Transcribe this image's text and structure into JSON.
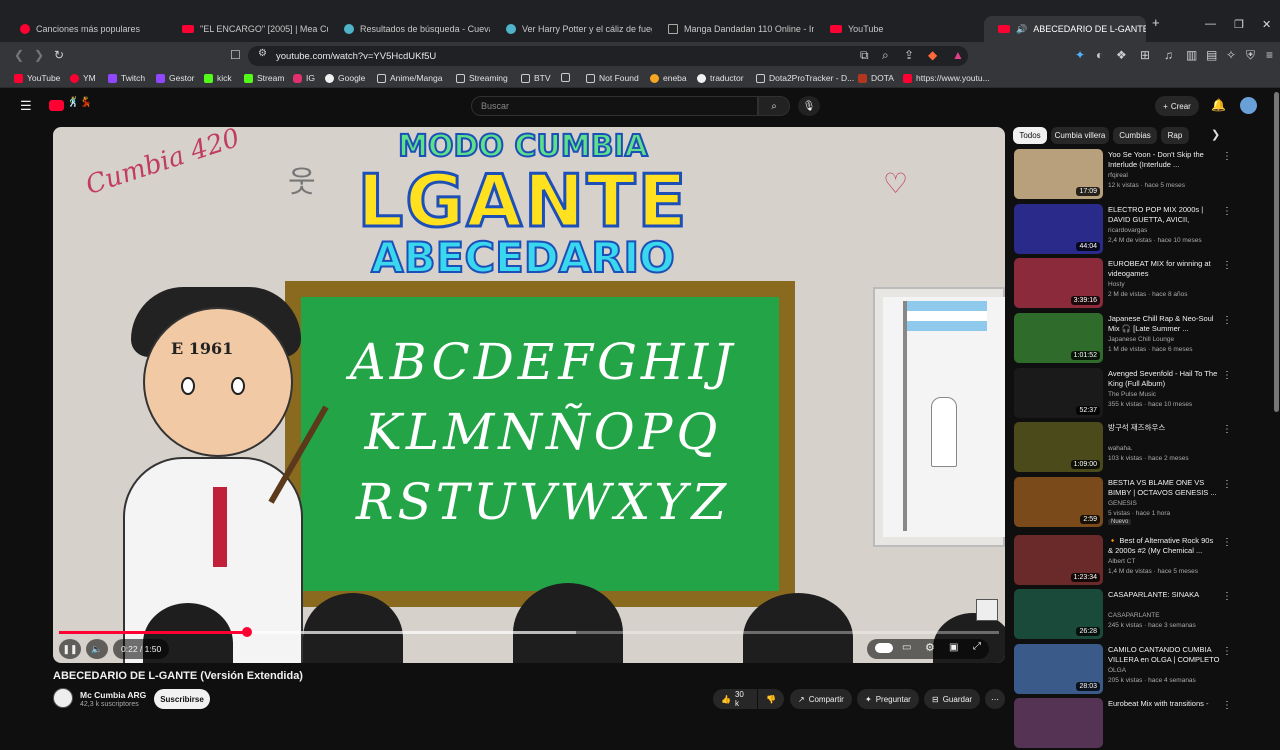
{
  "browser": {
    "tabs": [
      {
        "label": "Canciones más populares",
        "active": false
      },
      {
        "label": "\"EL ENCARGO\" [2005] | Mea Culpa. A...",
        "active": false
      },
      {
        "label": "Resultados de búsqueda - Cueva...",
        "active": false
      },
      {
        "label": "Ver Harry Potter y el cáliz de fuego 20...",
        "active": false
      },
      {
        "label": "Manga Dandadan 110 Online - InMa...",
        "active": false
      },
      {
        "label": "YouTube",
        "active": false
      },
      {
        "label": "ABECEDARIO DE L-GANTE (V...",
        "active": true
      }
    ],
    "new_tab": "+",
    "url": "youtube.com/watch?v=YV5HcdUKf5U",
    "bookmarks": [
      "YouTube",
      "YM",
      "Twitch",
      "Gestor",
      "kick",
      "Stream",
      "IG",
      "Google",
      "Anime/Manga",
      "Streaming",
      "BTV",
      "",
      "Not Found",
      "eneba",
      "traductor",
      "Dota2ProTracker - D...",
      "DOTA",
      "https://www.youtu..."
    ]
  },
  "header": {
    "search_placeholder": "Buscar",
    "create_label": "Crear"
  },
  "player": {
    "thumb_title_top": "MODO CUMBIA",
    "thumb_title_main": "LGANTE",
    "thumb_title_sub": "ABECEDARIO",
    "board_line1": "ABCDEFGHIJ",
    "board_line2": "KLMNÑOPQ",
    "board_line3": "RSTUVWXYZ",
    "doodle_left": "Cumbia 420",
    "doodle_year": "E 1961",
    "time": "0:22 / 1:50",
    "progress": 0.2,
    "buffered": 0.55
  },
  "video": {
    "title": "ABECEDARIO DE L-GANTE (Versión Extendida)",
    "channel": "Mc Cumbia ARG",
    "subscribers": "42,3 k suscriptores",
    "subscribe_label": "Suscribirse",
    "likes": "30 k",
    "share_label": "Compartir",
    "ask_label": "Preguntar",
    "save_label": "Guardar"
  },
  "chips": [
    "Todos",
    "Cumbia villera",
    "Cumbias",
    "Rap"
  ],
  "recommendations": [
    {
      "title": "Yoo Se Yoon - Don't Skip the Interlude (Interlude ...",
      "channel": "rfqireal",
      "meta": "12 k vistas · hace 5 meses",
      "duration": "17:09",
      "color": "#b9a07c"
    },
    {
      "title": "ELECTRO POP MIX 2000s | DAVID GUETTA, AVICII, CALVIN...",
      "channel": "ricardovargas",
      "meta": "2,4 M de vistas · hace 10 meses",
      "duration": "44:04",
      "color": "#2a2a8a"
    },
    {
      "title": "EUROBEAT MIX for winning at videogames",
      "channel": "Hosty",
      "meta": "2 M de vistas · hace 8 años",
      "duration": "3:39:16",
      "color": "#8a2a3a"
    },
    {
      "title": "Japanese Chill Rap & Neo-Soul Mix 🎧 [Late Summer ...",
      "channel": "Japanese Chill Lounge",
      "meta": "1 M de vistas · hace 6 meses",
      "duration": "1:01:52",
      "color": "#2f6b2a"
    },
    {
      "title": "Avenged Sevenfold - Hail To The King (Full Album)",
      "channel": "The Pulse Music",
      "meta": "355 k vistas · hace 10 meses",
      "duration": "52:37",
      "color": "#1a1a1a"
    },
    {
      "title": "방구석 재즈하우스",
      "channel": "wahaha.",
      "meta": "103 k vistas · hace 2 meses",
      "duration": "1:09:00",
      "color": "#4a4a1a"
    },
    {
      "title": "BESTIA VS BLAME ONE VS BIMBY | OCTAVOS GENESIS ...",
      "channel": "GENESIS",
      "meta": "5 vistas · hace 1 hora",
      "duration": "2:59",
      "badge": "Nuevo",
      "color": "#7a4a1a"
    },
    {
      "title": "🔸 Best of Alternative Rock 90s & 2000s #2 (My Chemical ...",
      "channel": "Albert CT",
      "meta": "1,4 M de vistas · hace 5 meses",
      "duration": "1:23:34",
      "color": "#6a2a2a"
    },
    {
      "title": "CASAPARLANTE: SINAKA",
      "channel": "CASAPARLANTE",
      "meta": "245 k vistas · hace 3 semanas",
      "duration": "26:28",
      "color": "#1a4a3a"
    },
    {
      "title": "CAMILO CANTANDO CUMBIA VILLERA en OLGA | COMPLETO",
      "channel": "OLGA",
      "meta": "205 k vistas · hace 4 semanas",
      "duration": "28:03",
      "color": "#3a5a8a"
    },
    {
      "title": "Eurobeat Mix with transitions -",
      "channel": "",
      "meta": "",
      "duration": "",
      "color": "#553355"
    }
  ]
}
